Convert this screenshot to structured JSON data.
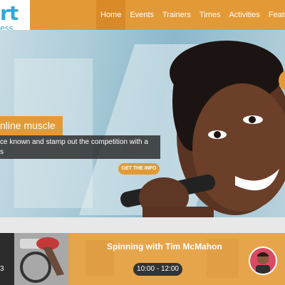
{
  "brand": {
    "logo_text": "rt",
    "logo_sub": "ess"
  },
  "nav": {
    "items": [
      "Home",
      "Events",
      "Trainers",
      "Times",
      "Activities",
      "Features"
    ]
  },
  "hero": {
    "caption_title": "nline muscle",
    "caption_body_line1": "ce known and stamp out the competition with a",
    "caption_body_line2": "s",
    "button": "GET THE INFO",
    "next_arrow": "›"
  },
  "schedule": {
    "class_title": "Spinning with Tim McMahon",
    "time": "10:00 - 12:00",
    "thumb_number": "3"
  },
  "colors": {
    "accent": "#e39a36",
    "logo": "#2fa8d8",
    "dark": "#333333"
  }
}
